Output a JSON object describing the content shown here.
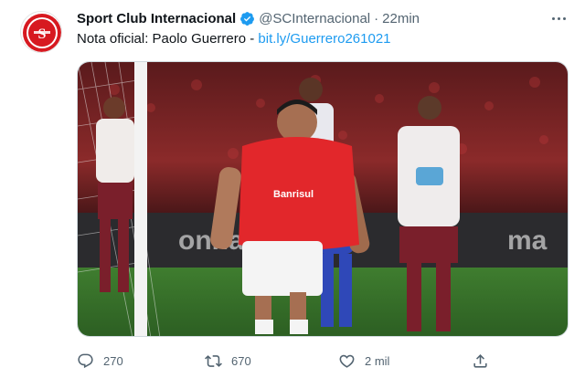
{
  "tweet": {
    "display_name": "Sport Club Internacional",
    "handle": "@SCInternacional",
    "separator": "·",
    "time": "22min",
    "text_prefix": "Nota oficial: Paolo Guerrero - ",
    "link": "bit.ly/Guerrero261021",
    "verified": true,
    "avatar_icon": "sc-internacional-crest-icon",
    "media": {
      "description_icon": "football-celebration-photo",
      "shirt_text": "Banrisul"
    },
    "actions": {
      "replies": "270",
      "retweets": "670",
      "likes": "2 mil",
      "reply_icon": "reply-icon",
      "retweet_icon": "retweet-icon",
      "like_icon": "heart-icon",
      "share_icon": "share-icon"
    },
    "colors": {
      "link": "#1d9bf0",
      "verified": "#1d9bf0",
      "club_red": "#d71920",
      "muted": "#536471"
    }
  }
}
